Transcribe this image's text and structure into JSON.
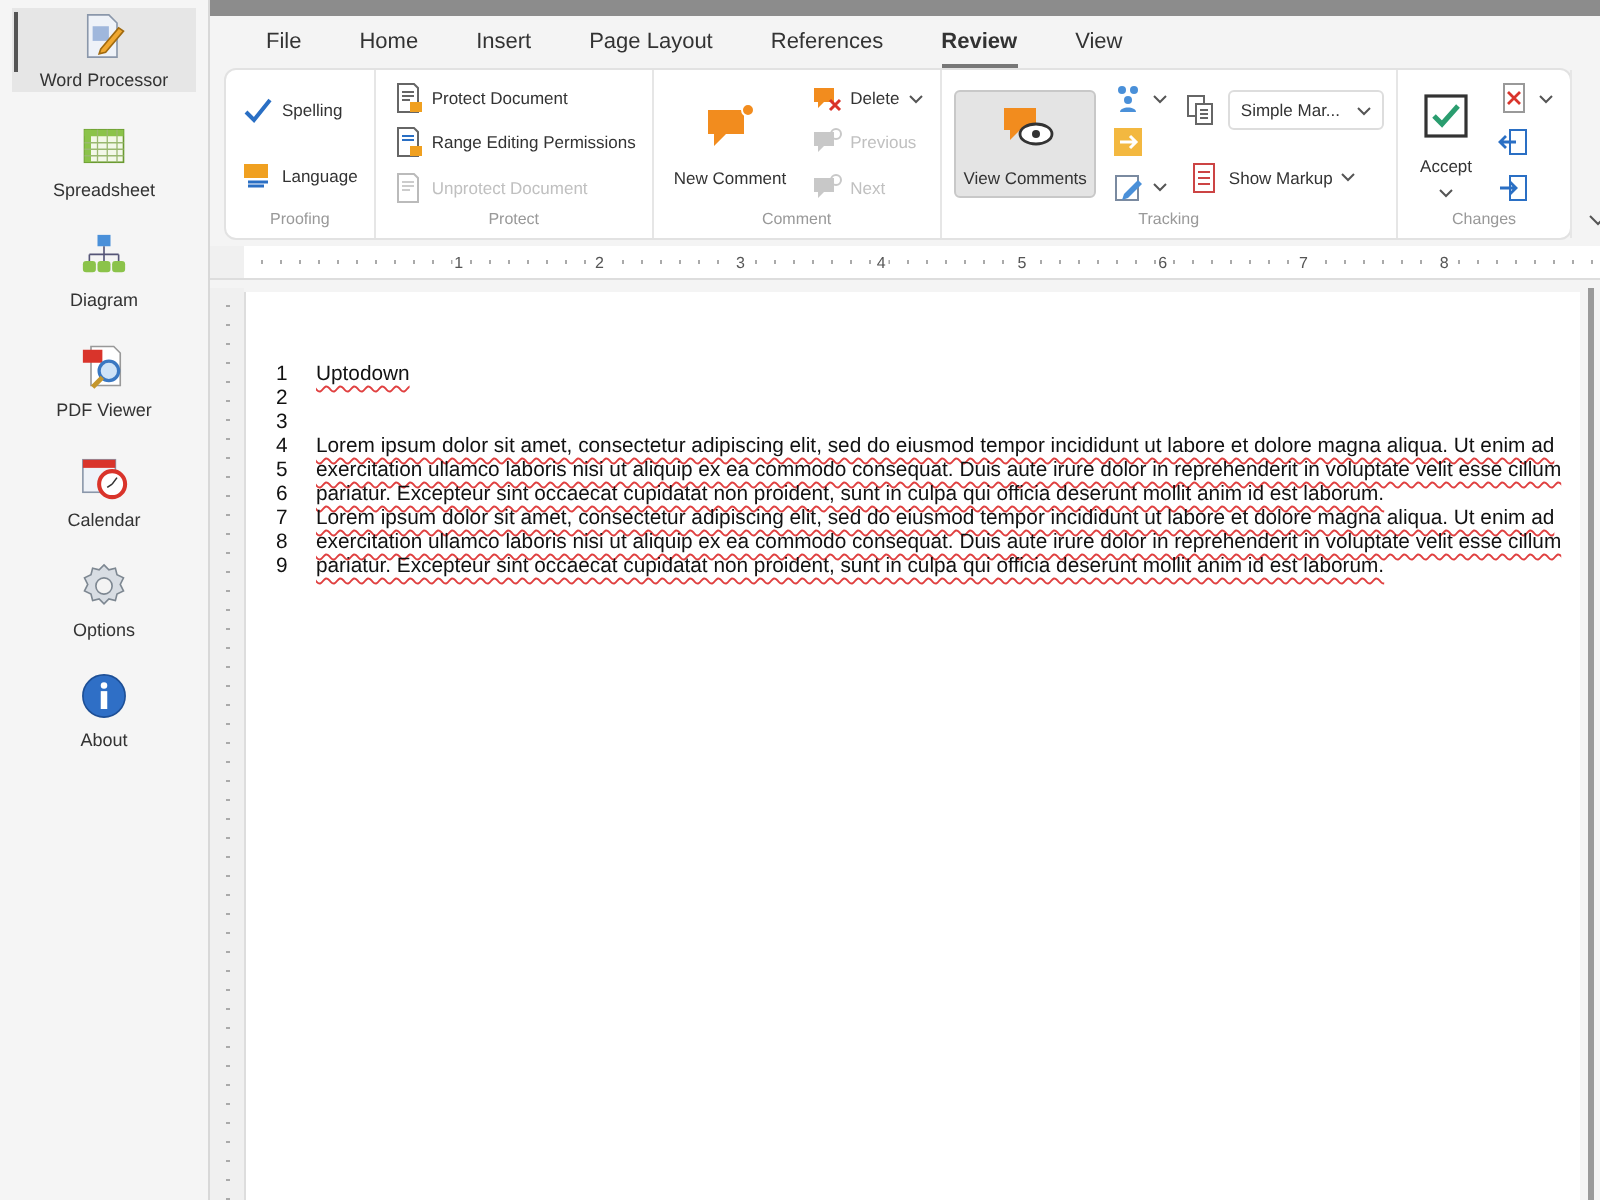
{
  "sidebar": {
    "items": [
      {
        "label": "Word Processor",
        "selected": true
      },
      {
        "label": "Spreadsheet",
        "selected": false
      },
      {
        "label": "Diagram",
        "selected": false
      },
      {
        "label": "PDF Viewer",
        "selected": false
      },
      {
        "label": "Calendar",
        "selected": false
      },
      {
        "label": "Options",
        "selected": false
      },
      {
        "label": "About",
        "selected": false
      }
    ]
  },
  "tabs": [
    {
      "label": "File",
      "selected": false
    },
    {
      "label": "Home",
      "selected": false
    },
    {
      "label": "Insert",
      "selected": false
    },
    {
      "label": "Page Layout",
      "selected": false
    },
    {
      "label": "References",
      "selected": false
    },
    {
      "label": "Review",
      "selected": true
    },
    {
      "label": "View",
      "selected": false
    }
  ],
  "ribbon": {
    "groups": [
      {
        "label": "Proofing",
        "columns": [
          [
            {
              "kind": "small",
              "label": "Spelling",
              "disabled": false,
              "pressed": false,
              "has_menu": false
            },
            {
              "kind": "small",
              "label": "Language",
              "disabled": false,
              "pressed": false,
              "has_menu": false
            }
          ]
        ]
      },
      {
        "label": "Protect",
        "columns": [
          [
            {
              "kind": "small",
              "label": "Protect Document",
              "disabled": false,
              "pressed": false,
              "has_menu": false
            },
            {
              "kind": "small",
              "label": "Range Editing Permissions",
              "disabled": false,
              "pressed": false,
              "has_menu": false
            },
            {
              "kind": "small",
              "label": "Unprotect Document",
              "disabled": true,
              "pressed": false,
              "has_menu": false
            }
          ]
        ]
      },
      {
        "label": "Comment",
        "columns": [
          [
            {
              "kind": "large",
              "label": "New Comment",
              "disabled": false,
              "pressed": false,
              "has_menu": false
            }
          ],
          [
            {
              "kind": "small",
              "label": "Delete",
              "disabled": false,
              "pressed": false,
              "has_menu": true
            },
            {
              "kind": "small",
              "label": "Previous",
              "disabled": true,
              "pressed": false,
              "has_menu": false
            },
            {
              "kind": "small",
              "label": "Next",
              "disabled": true,
              "pressed": false,
              "has_menu": false
            }
          ]
        ]
      },
      {
        "label": "Tracking",
        "columns": [
          [
            {
              "kind": "large",
              "label": "View Comments",
              "disabled": false,
              "pressed": true,
              "has_menu": false
            }
          ],
          [
            {
              "kind": "icon",
              "disabled": false,
              "pressed": false,
              "has_menu": true
            },
            {
              "kind": "icon",
              "disabled": false,
              "pressed": false,
              "has_menu": false
            },
            {
              "kind": "icon",
              "disabled": false,
              "pressed": false,
              "has_menu": true
            }
          ],
          [
            {
              "kind": "dropdown",
              "label": "Simple Mar...",
              "disabled": false,
              "pressed": false,
              "has_menu": true
            },
            {
              "kind": "small",
              "label": "Show Markup",
              "disabled": false,
              "pressed": false,
              "has_menu": true
            }
          ]
        ]
      },
      {
        "label": "Changes",
        "columns": [
          [
            {
              "kind": "large",
              "label": "Accept",
              "disabled": false,
              "pressed": false,
              "has_menu": true
            }
          ],
          [
            {
              "kind": "icon",
              "disabled": false,
              "pressed": false,
              "has_menu": true
            },
            {
              "kind": "icon",
              "disabled": false,
              "pressed": false,
              "has_menu": false
            },
            {
              "kind": "icon",
              "disabled": false,
              "pressed": false,
              "has_menu": false
            }
          ]
        ]
      }
    ]
  },
  "ruler": {
    "marks": [
      "1",
      "2",
      "3",
      "4",
      "5",
      "6",
      "7",
      "8"
    ]
  },
  "document": {
    "lines": [
      {
        "number": "1",
        "text": "Uptodown"
      },
      {
        "number": "2"
      },
      {
        "number": "3"
      },
      {
        "number": "4",
        "text": "Lorem ipsum dolor sit amet, consectetur adipiscing elit, sed do eiusmod tempor incididunt ut labore et dolore magna aliqua. Ut enim ad"
      },
      {
        "number": "5",
        "text": "exercitation ullamco laboris nisi ut aliquip ex ea commodo consequat. Duis aute irure dolor in reprehenderit in voluptate velit esse cillum"
      },
      {
        "number": "6",
        "text": "pariatur. Excepteur sint occaecat cupidatat non proident, sunt in culpa qui officia deserunt mollit anim id est laborum."
      },
      {
        "number": "7",
        "text": "Lorem ipsum dolor sit amet, consectetur adipiscing elit, sed do eiusmod tempor incididunt ut labore et dolore magna aliqua. Ut enim ad"
      },
      {
        "number": "8",
        "text": "exercitation ullamco laboris nisi ut aliquip ex ea commodo consequat. Duis aute irure dolor in reprehenderit in voluptate velit esse cillum"
      },
      {
        "number": "9",
        "text": "pariatur. Excepteur sint occaecat cupidatat non proident, sunt in culpa qui officia deserunt mollit anim id est laborum."
      }
    ]
  }
}
